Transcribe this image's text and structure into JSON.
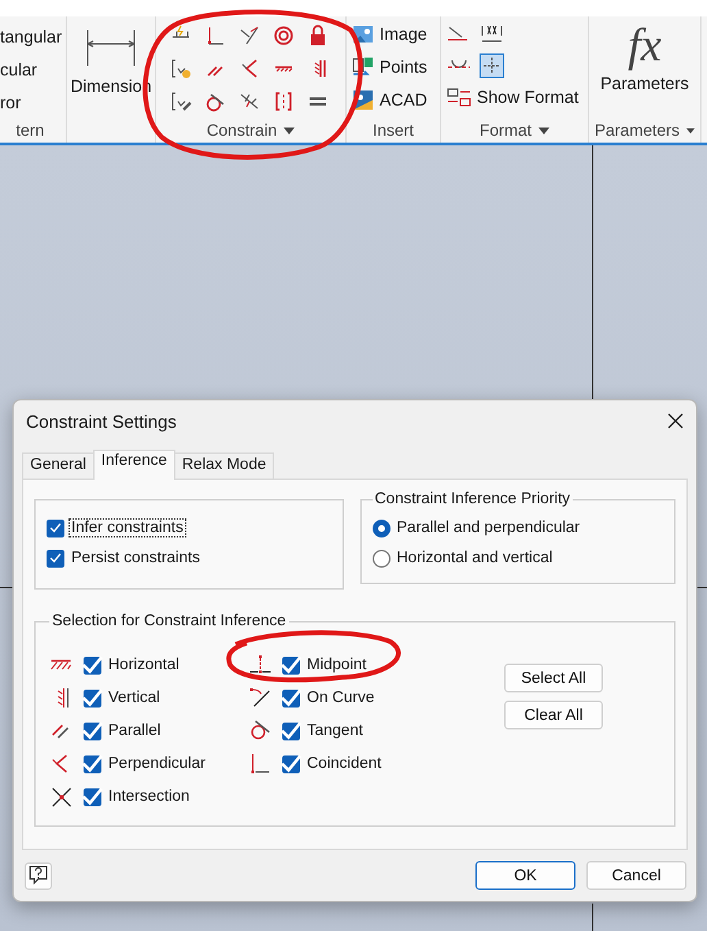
{
  "ribbon": {
    "panels": [
      {
        "kind": "list",
        "title": "tern",
        "items": [
          "tangular",
          "cular",
          "ror"
        ]
      },
      {
        "kind": "dimension",
        "label": "Dimension"
      },
      {
        "kind": "constrain",
        "title": "Constrain",
        "menu": true
      },
      {
        "kind": "insert",
        "title": "Insert",
        "items": [
          "Image",
          "Points",
          "ACAD"
        ]
      },
      {
        "kind": "format",
        "title": "Format",
        "menu": true,
        "grid_toggle_selected": true,
        "items": [
          "Show Format"
        ]
      },
      {
        "kind": "parameters",
        "title": "Parameters",
        "menu": true,
        "symbol": "fx",
        "label": "Parameters"
      }
    ]
  },
  "dialog": {
    "title": "Constraint Settings",
    "tabs": [
      {
        "label": "General",
        "selected": false
      },
      {
        "label": "Inference",
        "selected": true
      },
      {
        "label": "Relax Mode",
        "selected": false
      }
    ],
    "options": [
      {
        "label": "Infer constraints",
        "checked": true,
        "focused": true
      },
      {
        "label": "Persist constraints",
        "checked": true,
        "focused": false
      }
    ],
    "priority": {
      "title": "Constraint Inference Priority",
      "choices": [
        {
          "label": "Parallel and perpendicular",
          "selected": true
        },
        {
          "label": "Horizontal and vertical",
          "selected": false
        }
      ]
    },
    "selection": {
      "title": "Selection for Constraint Inference",
      "columns": [
        [
          {
            "label": "Horizontal",
            "checked": true
          },
          {
            "label": "Vertical",
            "checked": true
          },
          {
            "label": "Parallel",
            "checked": true
          },
          {
            "label": "Perpendicular",
            "checked": true
          },
          {
            "label": "Intersection",
            "checked": true
          }
        ],
        [
          {
            "label": "Midpoint",
            "checked": true
          },
          {
            "label": "On Curve",
            "checked": true
          },
          {
            "label": "Tangent",
            "checked": true
          },
          {
            "label": "Coincident",
            "checked": true
          }
        ]
      ],
      "buttons": [
        "Select All",
        "Clear All"
      ]
    },
    "footer": {
      "buttons": [
        {
          "label": "OK",
          "default": true
        },
        {
          "label": "Cancel",
          "default": false
        }
      ]
    }
  }
}
